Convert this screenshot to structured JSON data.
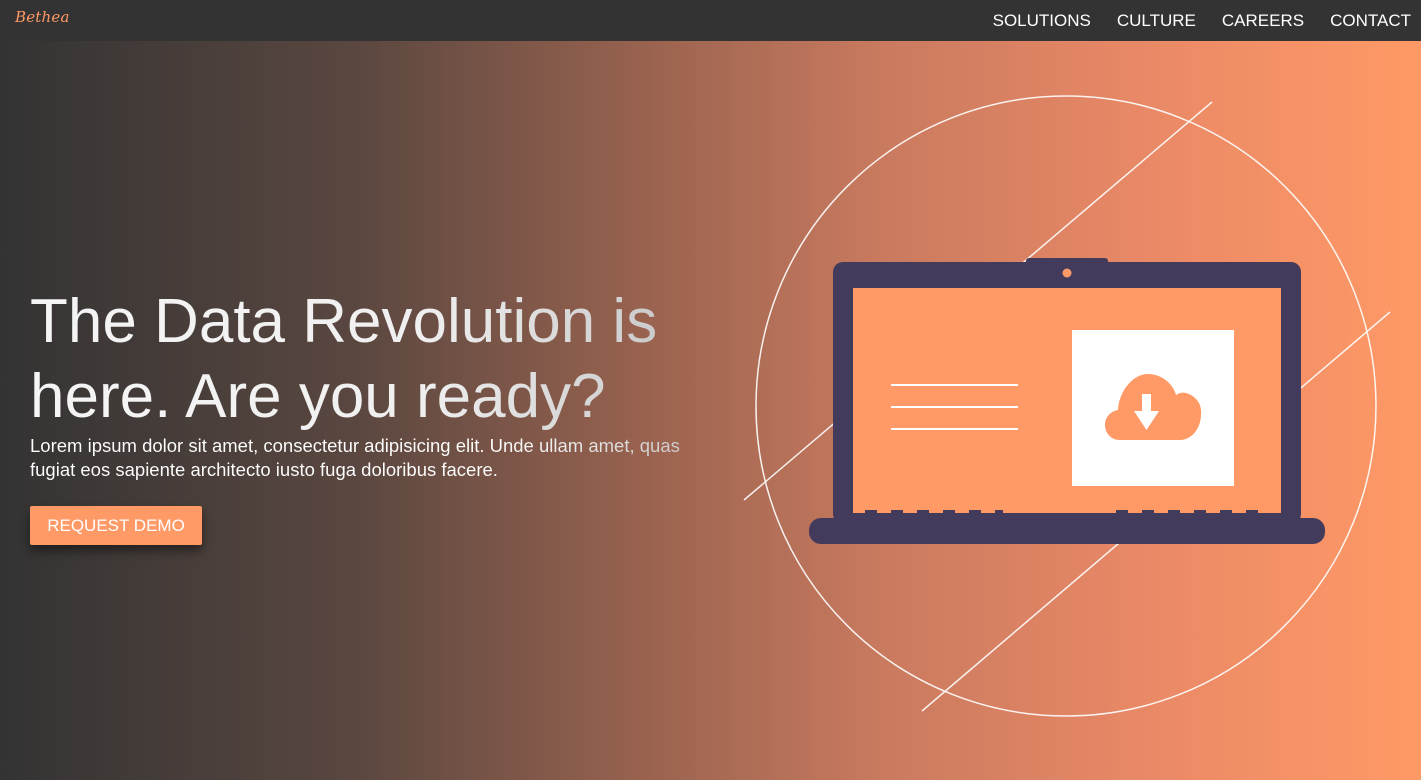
{
  "nav": {
    "brand": "Bethea",
    "links": [
      "SOLUTIONS",
      "CULTURE",
      "CAREERS",
      "CONTACT"
    ]
  },
  "hero": {
    "headline": "The Data Revolution is here. Are you ready?",
    "lead": "Lorem ipsum dolor sit amet, consectetur adipisicing elit. Unde ullam amet, quas fugiat eos sapiente architecto iusto fuga doloribus facere.",
    "cta_label": "REQUEST DEMO"
  },
  "colors": {
    "accent": "#ff9966",
    "navbar": "#333333",
    "laptop_frame": "#433b5c"
  },
  "illustration": {
    "icons": [
      "laptop-icon",
      "cloud-download-icon"
    ]
  }
}
